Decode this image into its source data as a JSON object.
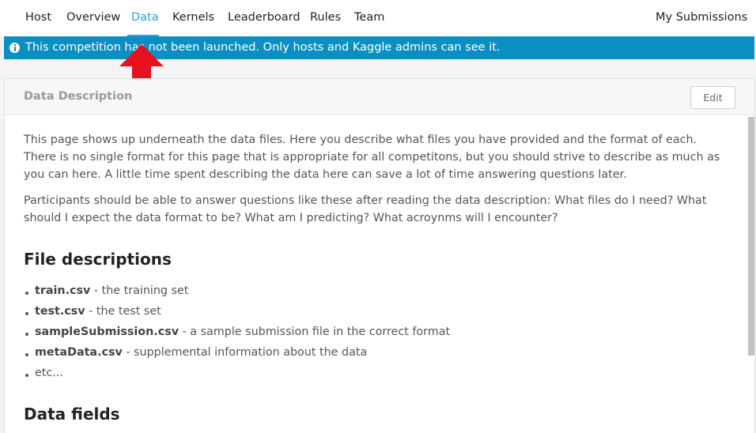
{
  "nav": {
    "items": [
      "Host",
      "Overview",
      "Data",
      "Kernels",
      "Leaderboard",
      "Rules",
      "Team"
    ],
    "active": "Data",
    "right_link": "My Submissions"
  },
  "banner": {
    "icon": "info-icon",
    "text": "This competition has not been launched. Only hosts and Kaggle admins can see it."
  },
  "annotation": {
    "icon": "red-arrow-up-icon",
    "color": "#e8101c"
  },
  "card": {
    "title": "Data Description",
    "edit_label": "Edit",
    "paragraphs": [
      "This page shows up underneath the data files. Here you describe what files you have provided and the format of each. There is no single format for this page that is appropriate for all competitons, but you should strive to describe as much as you can here. A little time spent describing the data here can save a lot of time answering questions later.",
      "Participants should be able to answer questions like these after reading the data description: What files do I need? What should I expect the data format to be? What am I predicting? What acroynms will I encounter?"
    ],
    "files_heading": "File descriptions",
    "files": [
      {
        "name": "train.csv",
        "desc": " - the training set"
      },
      {
        "name": "test.csv",
        "desc": " - the test set"
      },
      {
        "name": "sampleSubmission.csv",
        "desc": " - a sample submission file in the correct format"
      },
      {
        "name": "metaData.csv",
        "desc": " - supplemental information about the data"
      },
      {
        "name": "",
        "desc": "etc..."
      }
    ],
    "fields_heading": "Data fields"
  },
  "colors": {
    "accent": "#20a7d5",
    "banner_bg": "#0b8fc2",
    "arrow": "#e8101c"
  }
}
